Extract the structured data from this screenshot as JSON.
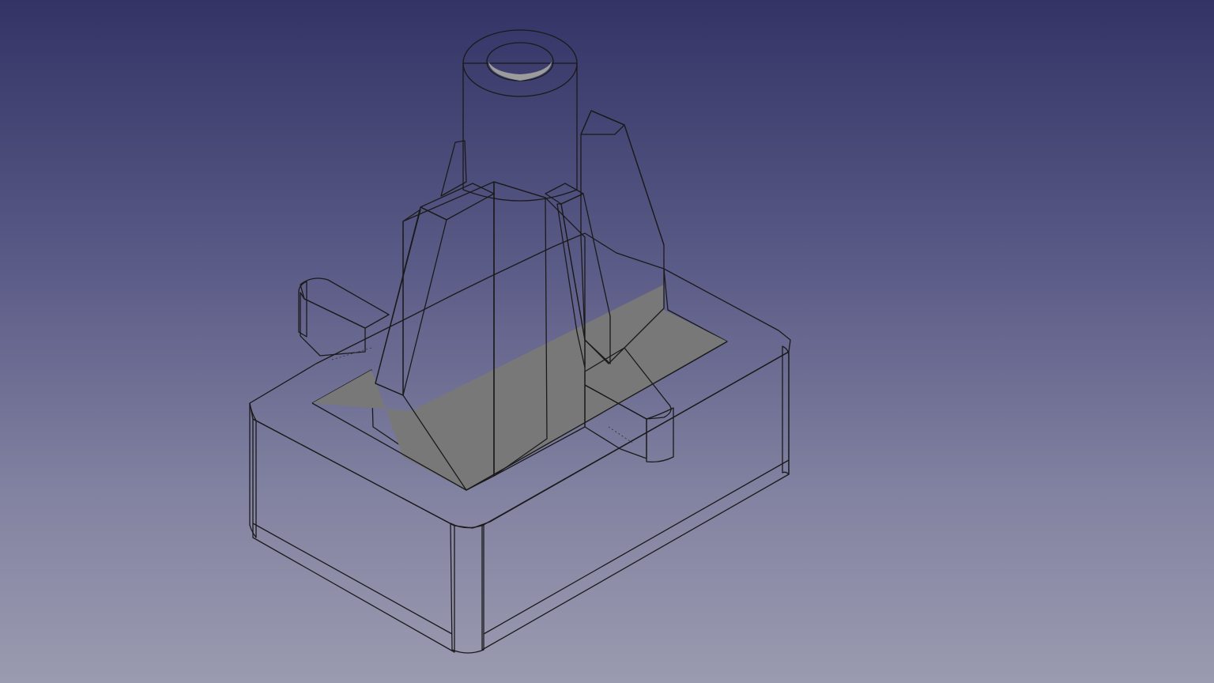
{
  "viewport": {
    "background_top": "#333366",
    "background_bottom": "#9a9ab0",
    "view": "isometric"
  },
  "model": {
    "part_color": "#7f7f7f",
    "highlight_color": "#a8a8a8",
    "shadow_color": "#6a6a6a",
    "edge_color": "#1a1a1a",
    "icon": "3d-part-icon"
  }
}
